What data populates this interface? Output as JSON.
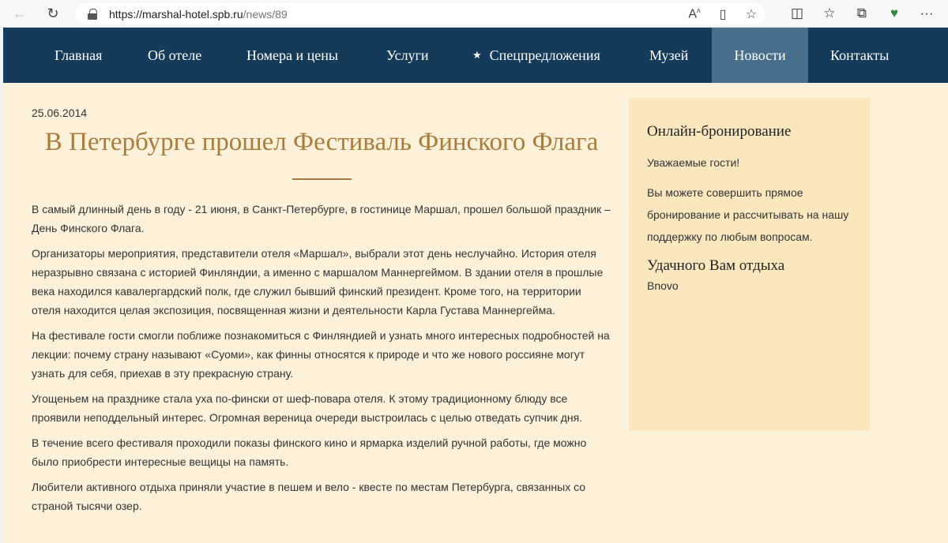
{
  "browser": {
    "url_host": "https://marshal-hotel.spb.ru",
    "url_path": "/news/89",
    "icons": [
      "back-arrow-icon",
      "reload-icon",
      "lock-icon",
      "read-aloud-icon",
      "immersive-reader-icon",
      "favorite-star-icon",
      "split-screen-icon",
      "favorites-icon",
      "collections-icon",
      "performance-icon",
      "more-icon"
    ]
  },
  "nav": {
    "items": [
      "Главная",
      "Об отеле",
      "Номера и цены",
      "Услуги",
      "Спецпредложения",
      "Музей",
      "Новости",
      "Контакты"
    ],
    "active_index": 6
  },
  "article": {
    "date": "25.06.2014",
    "title": "В Петербурге прошел Фестиваль Финского Флага",
    "paragraphs": [
      "В самый длинный день в году - 21 июня, в Санкт-Петербурге, в гостинице Маршал, прошел большой праздник – День Финского Флага.",
      "Организаторы мероприятия, представители  отеля «Маршал», выбрали этот день неслучайно. История отеля неразрывно связана с историей Финляндии, а именно с маршалом  Маннергеймом. В здании отеля в прошлые века находился кавалергардский полк, где служил бывший финский президент. Кроме того, на территории отеля находится целая экспозиция, посвященная жизни и деятельности Карла Густава Маннергейма.",
      "На фестивале гости смогли поближе познакомиться с Финляндией и узнать много интересных подробностей на лекции: почему страну называют «Суоми», как финны относятся к природе и что же нового россияне могут узнать для себя, приехав в эту прекрасную  страну.",
      "Угощеньем на празднике стала уха по-фински от шеф-повара отеля.  К этому традиционному блюду все проявили неподдельный интерес. Огромная вереница очереди выстроилась с целью отведать супчик  дня.",
      "В течение всего фестиваля проходили  показы финского кино и ярмарка изделий ручной работы, где можно было  приобрести интересные вещицы на память.",
      "Любители  активного  отдыха приняли участие в пешем и вело - квесте по местам Петербурга,  связанных со страной тысячи озер."
    ]
  },
  "sidebar": {
    "heading": "Онлайн-бронирование",
    "greeting": "Уважаемые гости!",
    "text": "Вы можете совершить прямое бронирование и рассчитывать на нашу поддержку по любым вопросам.",
    "heading2": "Удачного Вам отдыха",
    "provider": "Bnovo"
  },
  "colors": {
    "nav_bg": "#143c5a",
    "nav_active": "#476f8c",
    "page_bg": "#fdf2d9",
    "sidebar_bg": "#fbe7bd",
    "title": "#a87d3c"
  }
}
